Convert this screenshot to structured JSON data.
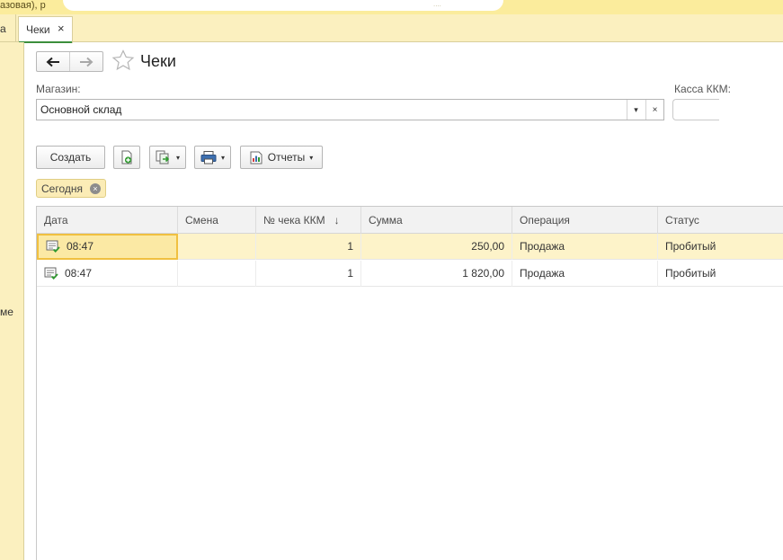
{
  "window": {
    "title_fragment": "азовая), р",
    "title_fragment_right": "...."
  },
  "tabs": {
    "previous_fragment": "а",
    "active": {
      "label": "Чеки",
      "close": "×"
    }
  },
  "left_panel": {
    "text_fragment": "ме"
  },
  "form": {
    "title": "Чеки",
    "store": {
      "label": "Магазин:",
      "value": "Основной склад",
      "dropdown": "▾",
      "clear": "×"
    },
    "kassa": {
      "label": "Касса ККМ:"
    }
  },
  "toolbar": {
    "create_label": "Создать",
    "reports_label": "Отчеты",
    "caret": "▾"
  },
  "filter": {
    "label": "Сегодня",
    "clear": "×"
  },
  "table": {
    "columns": [
      {
        "label": "Дата"
      },
      {
        "label": "Смена"
      },
      {
        "label": "№ чека ККМ",
        "sort": "↓"
      },
      {
        "label": "Сумма"
      },
      {
        "label": "Операция"
      },
      {
        "label": "Статус"
      }
    ],
    "rows": [
      {
        "date": "08:47",
        "shift": "",
        "receipt_no": "1",
        "amount": "250,00",
        "operation": "Продажа",
        "status": "Пробитый"
      },
      {
        "date": "08:47",
        "shift": "",
        "receipt_no": "1",
        "amount": "1 820,00",
        "operation": "Продажа",
        "status": "Пробитый"
      }
    ]
  },
  "colors": {
    "panel_yellow": "#fbf0bf",
    "selected_row": "#fdf3c9",
    "focus_border": "#f0c040",
    "tab_accent": "#3c8f3c"
  }
}
